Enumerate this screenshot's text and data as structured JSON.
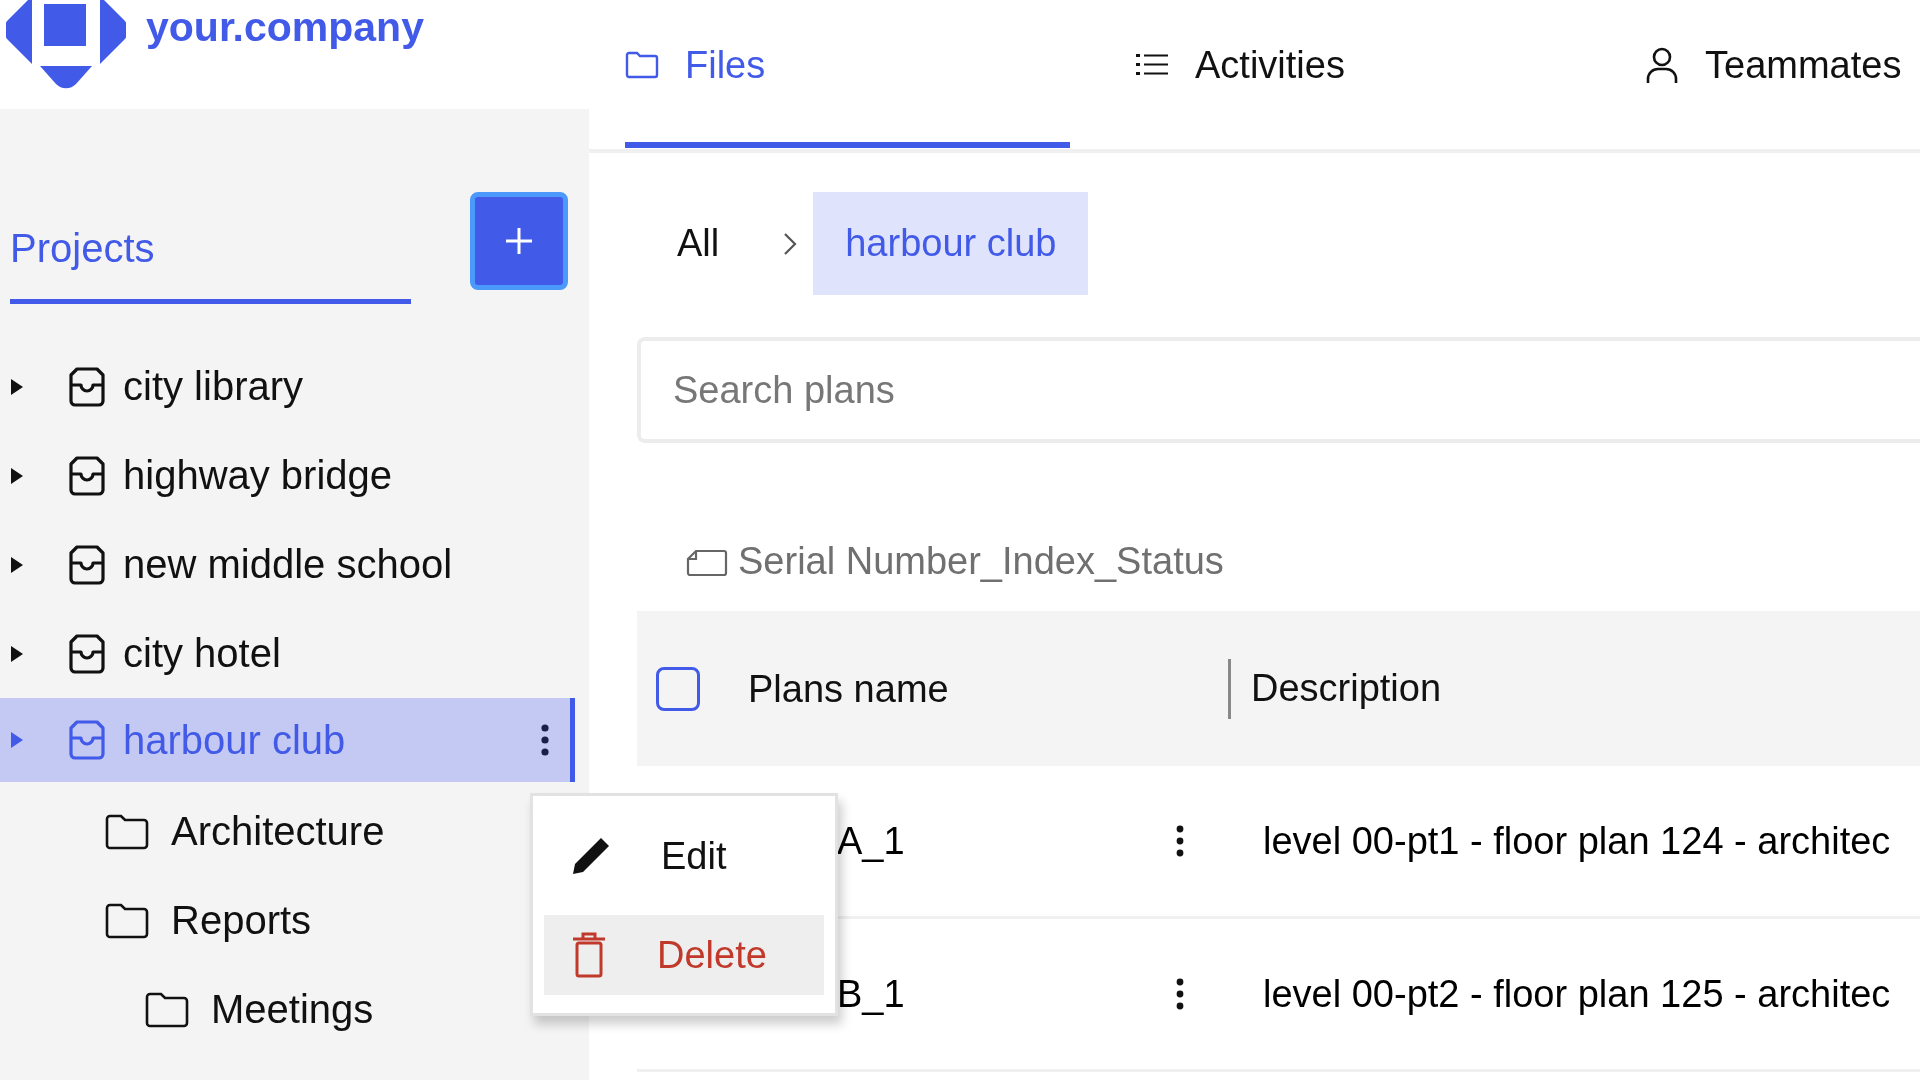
{
  "logo": {
    "text": "your.company"
  },
  "tabs": [
    {
      "label": "Files",
      "kind": "folder",
      "selected": true
    },
    {
      "label": "Activities",
      "kind": "list",
      "selected": false
    },
    {
      "label": "Teammates",
      "kind": "person",
      "selected": false
    }
  ],
  "sidebar": {
    "title": "Projects",
    "items": [
      {
        "label": "city library",
        "kind": "project",
        "selected": false
      },
      {
        "label": "highway bridge",
        "kind": "project",
        "selected": false
      },
      {
        "label": "new middle school",
        "kind": "project",
        "selected": false
      },
      {
        "label": "city hotel",
        "kind": "project",
        "selected": false
      },
      {
        "label": "harbour club",
        "kind": "project",
        "selected": true,
        "children": [
          {
            "label": "Architecture",
            "kind": "folder",
            "selected": false
          },
          {
            "label": "Reports",
            "kind": "folder",
            "selected": false,
            "children": [
              {
                "label": "Meetings",
                "kind": "folder",
                "selected": false
              }
            ]
          }
        ]
      }
    ]
  },
  "breadcrumb": [
    {
      "label": "All",
      "selected": false
    },
    {
      "label": "harbour club",
      "selected": true
    }
  ],
  "search": {
    "placeholder": "Search plans"
  },
  "group_label": "Serial Number_Index_Status",
  "table": {
    "select_all": {
      "checked": false
    },
    "columns": [
      "Plans name",
      "Description"
    ],
    "rows": [
      {
        "name": "A_1",
        "description": "level 00-pt1 - floor plan 124 - architec"
      },
      {
        "name": "B_1",
        "description": "level 00-pt2 - floor plan 125 - architec"
      }
    ]
  },
  "context_menu": {
    "items": [
      {
        "label": "Edit",
        "kind": "edit",
        "selected": false
      },
      {
        "label": "Delete",
        "kind": "delete",
        "selected": true
      }
    ]
  }
}
